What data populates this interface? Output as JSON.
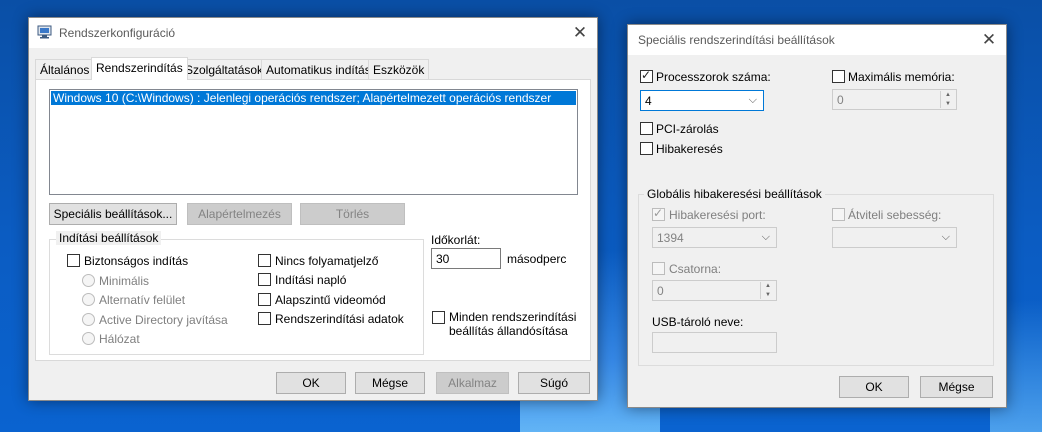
{
  "sysconfig": {
    "title": "Rendszerkonfiguráció",
    "tabs": [
      "Általános",
      "Rendszerindítás",
      "Szolgáltatások",
      "Automatikus indítás",
      "Eszközök"
    ],
    "os_entries": [
      "Windows 10 (C:\\Windows) : Jelenlegi operációs rendszer; Alapértelmezett operációs rendszer"
    ],
    "buttons": {
      "advanced": "Speciális beállítások...",
      "set_default": "Alapértelmezés",
      "delete": "Törlés"
    },
    "boot_options": {
      "title": "Indítási beállítások",
      "safe_boot": "Biztonságos indítás",
      "minimal": "Minimális",
      "alternate_shell": "Alternatív felület",
      "ad_repair": "Active Directory javítása",
      "network": "Hálózat",
      "no_gui_boot": "Nincs folyamatjelző",
      "boot_log": "Indítási napló",
      "base_video": "Alapszintű videomód",
      "os_boot_info": "Rendszerindítási adatok"
    },
    "timeout": {
      "label": "Időkorlát:",
      "value": "30",
      "unit": "másodperc"
    },
    "make_permanent": {
      "line1": "Minden rendszerindítási",
      "line2": "beállítás állandósítása"
    },
    "footer": {
      "ok": "OK",
      "cancel": "Mégse",
      "apply": "Alkalmaz",
      "help": "Súgó"
    }
  },
  "advanced": {
    "title": "Speciális rendszerindítási beállítások",
    "num_processors": {
      "label": "Processzorok száma:",
      "checked": true,
      "value": "4"
    },
    "max_memory": {
      "label": "Maximális memória:",
      "checked": false,
      "value": "0"
    },
    "pci_lock": {
      "label": "PCI-zárolás",
      "checked": false
    },
    "debug": {
      "label": "Hibakeresés",
      "checked": false
    },
    "global_debug": {
      "title": "Globális hibakeresési beállítások",
      "debug_port": {
        "label": "Hibakeresési port:",
        "checked": true,
        "value": "1394"
      },
      "baud_rate": {
        "label": "Átviteli sebesség:",
        "checked": false,
        "value": ""
      },
      "channel": {
        "label": "Csatorna:",
        "checked": false,
        "value": "0"
      },
      "usb_target": {
        "label": "USB-tároló neve:",
        "value": ""
      }
    },
    "footer": {
      "ok": "OK",
      "cancel": "Mégse"
    }
  }
}
